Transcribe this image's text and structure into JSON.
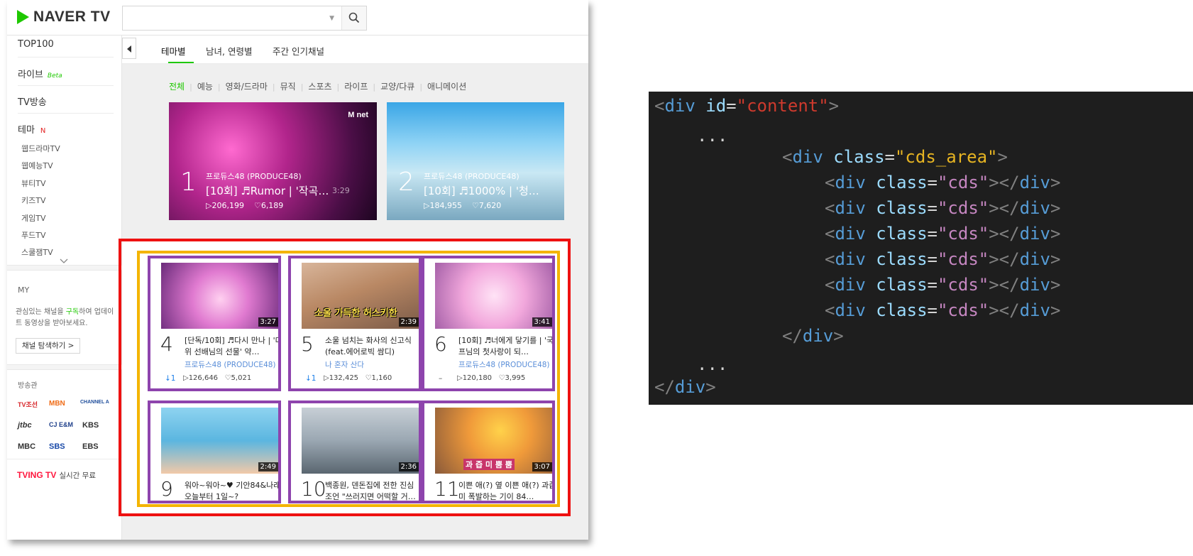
{
  "header": {
    "logo_text": "NAVER TV",
    "search_placeholder": ""
  },
  "sidebar": {
    "top100": "TOP100",
    "live": "라이브",
    "live_badge": "Beta",
    "tv": "TV방송",
    "theme": "테마",
    "theme_badge": "N",
    "theme_items": [
      "웹드라마TV",
      "웹예능TV",
      "뷰티TV",
      "키즈TV",
      "게임TV",
      "푸드TV",
      "스쿨잼TV"
    ],
    "my_title": "MY",
    "my_desc_1": "관심있는 채널을 ",
    "my_desc_link": "구독",
    "my_desc_2": "하여 업데이트 동영상을 받아보세요.",
    "explore_button": "채널 탐색하기 >",
    "broadcasters_title": "방송관",
    "broadcasters": [
      "TV조선",
      "MBN",
      "CHANNEL A",
      "jtbc",
      "CJ E&M",
      "KBS",
      "MBC",
      "SBS",
      "EBS"
    ],
    "tving_brand": "TVING TV",
    "tving_sub": "실시간 무료"
  },
  "tabs": [
    "테마별",
    "남녀, 연령별",
    "주간 인기채널"
  ],
  "categories": [
    "전체",
    "예능",
    "영화/드라마",
    "뮤직",
    "스포츠",
    "라이프",
    "교양/다큐",
    "애니메이션"
  ],
  "heroes": [
    {
      "rank": "1",
      "channel": "프로듀스48 (PRODUCE48)",
      "title": "[10회] ♬Rumor | '작곡…",
      "views": "▷206,199",
      "likes": "♡6,189",
      "duration": "3:29",
      "badge": "M net"
    },
    {
      "rank": "2",
      "channel": "프로듀스48 (PRODUCE48)",
      "title": "[10회] ♬1000% | '청…",
      "views": "▷184,955",
      "likes": "♡7,620"
    }
  ],
  "cards": [
    {
      "rank": "4",
      "title": "[단독/10회] ♬다시 만나 | '대위 선배님의 선물' 약…",
      "channel": "프로듀스48 (PRODUCE48)",
      "change": "↓1",
      "views": "▷126,646",
      "likes": "♡5,021",
      "duration": "3:27"
    },
    {
      "rank": "5",
      "title": "소울 넘치는 화사의 신고식 (feat.에어로빅 쌈디)",
      "channel": "나 혼자 산다",
      "change": "↓1",
      "views": "▷132,425",
      "likes": "♡1,160",
      "duration": "2:39",
      "caption": "소울 가득한 허스키한"
    },
    {
      "rank": "6",
      "title": "[10회] ♬너에게 닿기를 | '국.프님의 첫사랑이 되…",
      "channel": "프로듀스48 (PRODUCE48)",
      "change": "–",
      "views": "▷120,180",
      "likes": "♡3,995",
      "duration": "3:41"
    },
    {
      "rank": "9",
      "title": "워아~워아~♥ 기안84&나래 오늘부터 1일~?",
      "duration": "2:49"
    },
    {
      "rank": "10",
      "title": "백종원, 덴돈집에 전한 진심 조언 \"쓰러지면 어떡할 거…",
      "duration": "2:36"
    },
    {
      "rank": "11",
      "title": "이쁜 애(?) 옆 이쁜 애(?) 과즙미 폭발하는 기이 84…",
      "duration": "3:07",
      "caption": "과 즙 미 뿜 뿜"
    }
  ],
  "code": {
    "content_id": "\"content\"",
    "cds_area_class": "\"cds_area\"",
    "cds_class": "\"cds\"",
    "ellipsis": "..."
  },
  "colors": {
    "brand_green": "#1ec800",
    "box_red": "#ee1111",
    "box_orange": "#f4b400",
    "box_purple": "#8e44ad",
    "code_bg": "#1e1e1e"
  }
}
